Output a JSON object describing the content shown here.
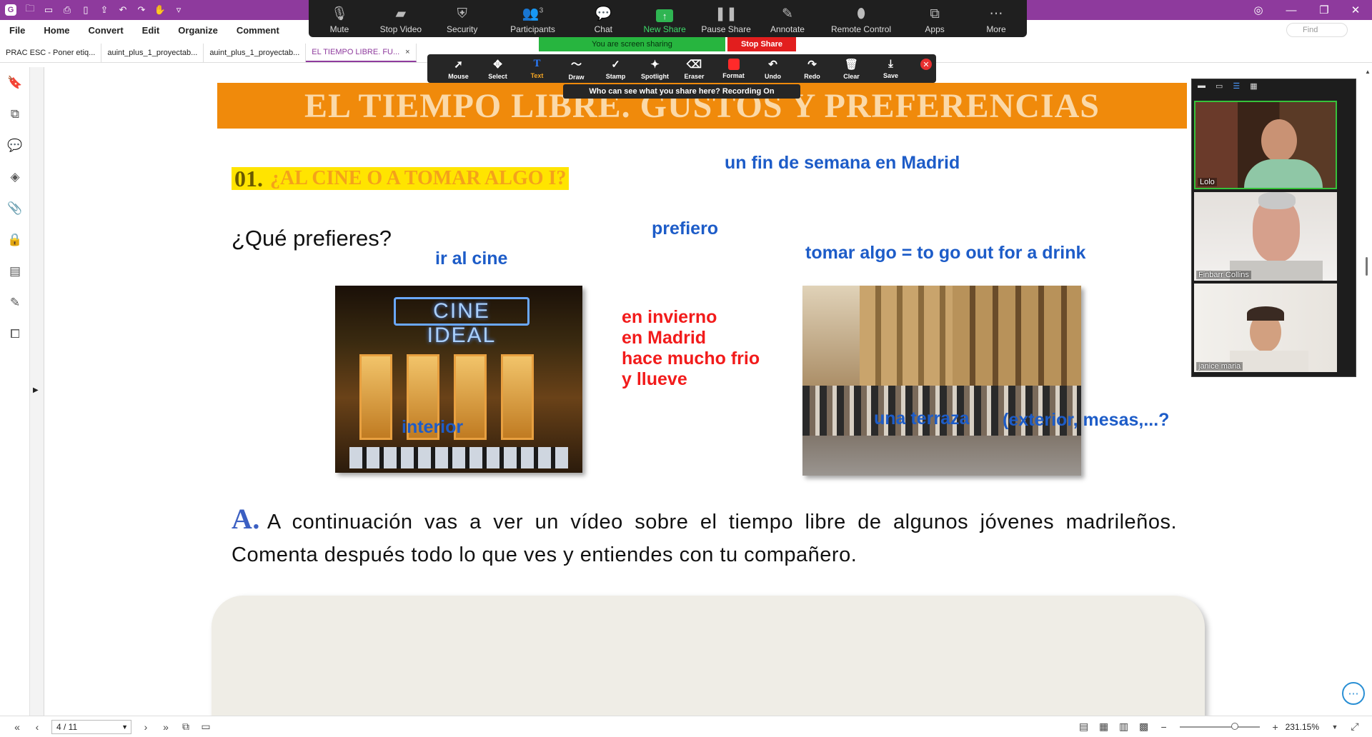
{
  "titlebar": {
    "icons": [
      "logo-icon",
      "open-folder-icon",
      "save-icon",
      "print-icon",
      "new-doc-icon",
      "export-icon",
      "undo-icon",
      "redo-icon",
      "hand-tool-icon",
      "customize-icon"
    ]
  },
  "menu": {
    "items": [
      "File",
      "Home",
      "Convert",
      "Edit",
      "Organize",
      "Comment"
    ]
  },
  "find": {
    "placeholder": "Find"
  },
  "tabs": [
    {
      "label": "PRAC ESC - Poner etiq..."
    },
    {
      "label": "auint_plus_1_proyectab..."
    },
    {
      "label": "auint_plus_1_proyectab..."
    },
    {
      "label": "EL TIEMPO LIBRE. FU...",
      "close": "×"
    }
  ],
  "zoom": {
    "toolbar": [
      {
        "label": "Mute"
      },
      {
        "label": "Stop Video"
      },
      {
        "label": "Security"
      },
      {
        "label": "Participants",
        "count": "3"
      },
      {
        "label": "Chat"
      },
      {
        "label": "New Share"
      },
      {
        "label": "Pause Share"
      },
      {
        "label": "Annotate"
      },
      {
        "label": "Remote Control"
      },
      {
        "label": "Apps"
      },
      {
        "label": "More"
      }
    ],
    "sharing_text": "You are screen sharing",
    "stop_share": "Stop Share",
    "annotate_tools": [
      "Mouse",
      "Select",
      "Text",
      "Draw",
      "Stamp",
      "Spotlight",
      "Eraser",
      "Format",
      "Undo",
      "Redo",
      "Clear",
      "Save"
    ],
    "who_can_see": "Who can see what you share here? Recording On",
    "participants": [
      {
        "name": "Lolo"
      },
      {
        "name": "Finbarr Collins"
      },
      {
        "name": "janice maria"
      }
    ]
  },
  "document": {
    "banner": "EL TIEMPO LIBRE. GUSTOS Y PREFERENCIAS",
    "section_number": "01.",
    "section_title": "¿AL CINE O A TOMAR ALGO I?",
    "question": "¿Qué prefieres?",
    "annotations_blue": {
      "fin_semana": "un fin de semana en Madrid",
      "prefiero": "prefiero",
      "ir_cine": "ir al cine",
      "tomar_algo": "tomar algo = to go out for a drink",
      "interior": "interior",
      "terraza": "una terraza",
      "exterior": "(exterior, mesas,...?"
    },
    "annotations_red": [
      "en invierno",
      "en Madrid",
      "hace mucho frio",
      "y llueve"
    ],
    "cine_sign": "CINE IDEAL",
    "activity_letter": "A.",
    "activity_text": "A continuación vas a ver un vídeo sobre el tiempo libre de algunos jóvenes madrileños. Comenta después todo lo que ves y entiendes con tu compañero."
  },
  "status": {
    "page": "4 / 11",
    "zoom": "231.15%"
  }
}
